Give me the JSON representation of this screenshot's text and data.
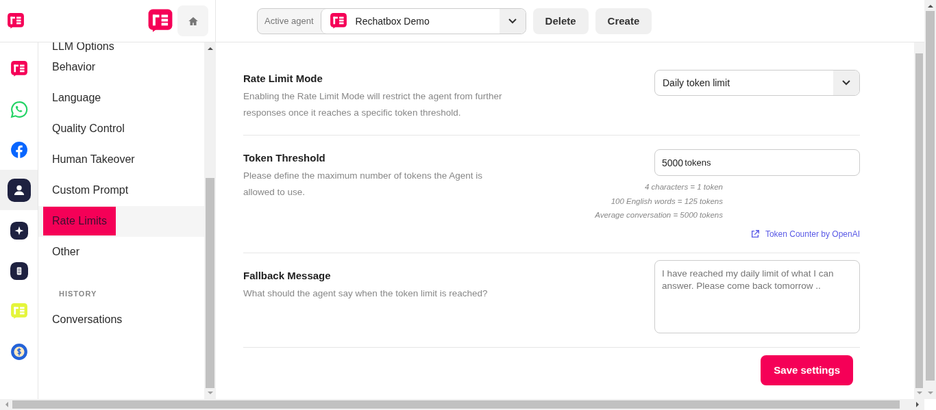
{
  "header": {
    "agent_label": "Active agent",
    "agent_name": "Rechatbox Demo",
    "buttons": [
      "Delete",
      "Create"
    ]
  },
  "rail": [
    {
      "kind": "brand",
      "selected": false
    },
    {
      "kind": "whatsapp",
      "selected": false
    },
    {
      "kind": "facebook",
      "selected": false
    },
    {
      "kind": "person",
      "selected": true
    },
    {
      "kind": "sparkle",
      "selected": false
    },
    {
      "kind": "document",
      "selected": false
    },
    {
      "kind": "brand-lime",
      "selected": false
    },
    {
      "kind": "dollar",
      "selected": false
    }
  ],
  "nav": {
    "items": [
      {
        "label": "LLM Options",
        "selected": false
      },
      {
        "label": "Behavior",
        "selected": false
      },
      {
        "label": "Language",
        "selected": false
      },
      {
        "label": "Quality Control",
        "selected": false
      },
      {
        "label": "Human Takeover",
        "selected": false
      },
      {
        "label": "Custom Prompt",
        "selected": false
      },
      {
        "label": "Rate Limits",
        "selected": true
      },
      {
        "label": "Other",
        "selected": false
      }
    ],
    "section": "HISTORY",
    "history_items": [
      {
        "label": "Conversations",
        "selected": false
      }
    ]
  },
  "settings": [
    {
      "kind": "select",
      "title": "Rate Limit Mode",
      "description": "Enabling the Rate Limit Mode will restrict the agent from further responses once it reaches a specific token threshold.",
      "value": "Daily token limit"
    },
    {
      "kind": "number",
      "title": "Token Threshold",
      "description": "Please define the maximum number of tokens the Agent is allowed to use.",
      "value": "5000",
      "unit": "tokens",
      "notes": [
        "4 characters = 1 token",
        "100 English words = 125 tokens",
        "Average conversation = 5000 tokens"
      ],
      "link": "Token Counter by OpenAI"
    },
    {
      "kind": "textarea",
      "title": "Fallback Message",
      "description": "What should the agent say when the token limit is reached?",
      "placeholder": "I have reached my daily limit of what I can answer. Please come back tomorrow .."
    }
  ],
  "save_button": "Save settings"
}
